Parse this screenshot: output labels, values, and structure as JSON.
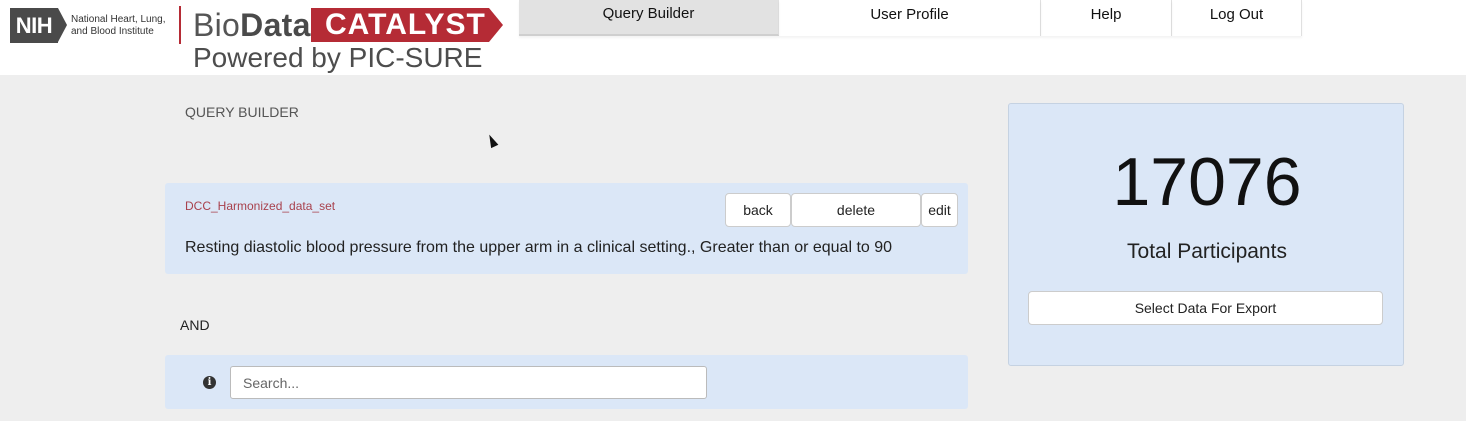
{
  "logo": {
    "nih": "NIH",
    "institute_line1": "National Heart, Lung,",
    "institute_line2": "and Blood Institute",
    "bio": "Bio",
    "data": "Data",
    "catalyst": "CATALYST",
    "powered_by": "Powered by PIC-SURE",
    "brand_color": "#b52b35"
  },
  "nav": {
    "tabs": [
      {
        "label": "Query Builder",
        "active": true
      },
      {
        "label": "User Profile",
        "active": false
      },
      {
        "label": "Help",
        "active": false
      },
      {
        "label": "Log Out",
        "active": false
      }
    ]
  },
  "query_builder": {
    "title": "QUERY BUILDER",
    "filter": {
      "category": "DCC_Harmonized_data_set",
      "description": "Resting diastolic blood pressure from the upper arm in a clinical setting., Greater than or equal to 90",
      "back_label": "back",
      "delete_label": "delete",
      "edit_label": "edit"
    },
    "operator": "AND",
    "search": {
      "placeholder": "Search...",
      "value": "",
      "info_icon": "info-icon"
    }
  },
  "summary": {
    "total": "17076",
    "total_label": "Total Participants",
    "export_label": "Select Data For Export"
  },
  "colors": {
    "panel_bg": "#dbe7f7",
    "page_bg": "#eeeeee",
    "category_text": "#a8414d"
  }
}
